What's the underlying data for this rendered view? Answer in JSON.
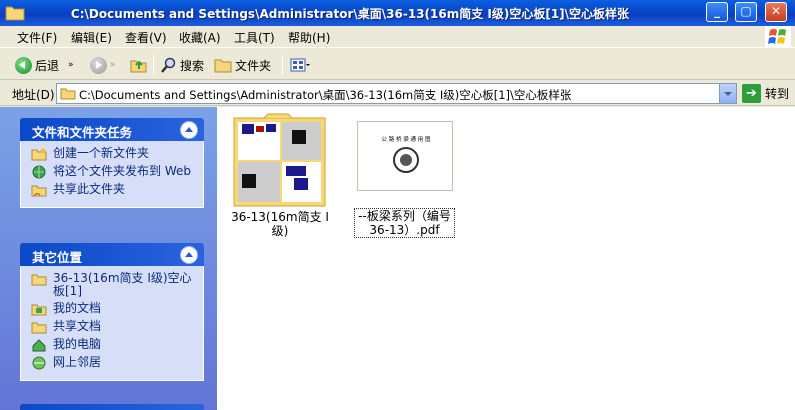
{
  "window": {
    "title": "C:\\Documents and Settings\\Administrator\\桌面\\36-13(16m简支 Ⅰ级)空心板[1]\\空心板样张",
    "min": "_",
    "max": "▢",
    "close": "✕"
  },
  "menu": [
    "文件(F)",
    "编辑(E)",
    "查看(V)",
    "收藏(A)",
    "工具(T)",
    "帮助(H)"
  ],
  "toolbar": {
    "back": "后退",
    "search": "搜索",
    "folders": "文件夹"
  },
  "address": {
    "label": "地址(D)",
    "value": "C:\\Documents and Settings\\Administrator\\桌面\\36-13(16m简支 Ⅰ级)空心板[1]\\空心板样张",
    "go": "转到"
  },
  "tasks_panel": {
    "title": "文件和文件夹任务",
    "items": [
      "创建一个新文件夹",
      "将这个文件夹发布到 Web",
      "共享此文件夹"
    ]
  },
  "places_panel": {
    "title": "其它位置",
    "items": [
      "36-13(16m简支 Ⅰ级)空心板[1]",
      "我的文档",
      "共享文档",
      "我的电脑",
      "网上邻居"
    ]
  },
  "files": [
    {
      "name": "36-13(16m简支 Ⅰ级)",
      "type": "folder"
    },
    {
      "name": "--板梁系列（编号 36-13）.pdf",
      "type": "pdf",
      "preview_title": "公 路 桥 梁 通 用 图"
    }
  ],
  "colors": {
    "title_bar": "#0A5FE0",
    "task_pane": "#7BA2E7",
    "panel_body": "#D6DFF7",
    "link_text": "#0C2A7E"
  }
}
